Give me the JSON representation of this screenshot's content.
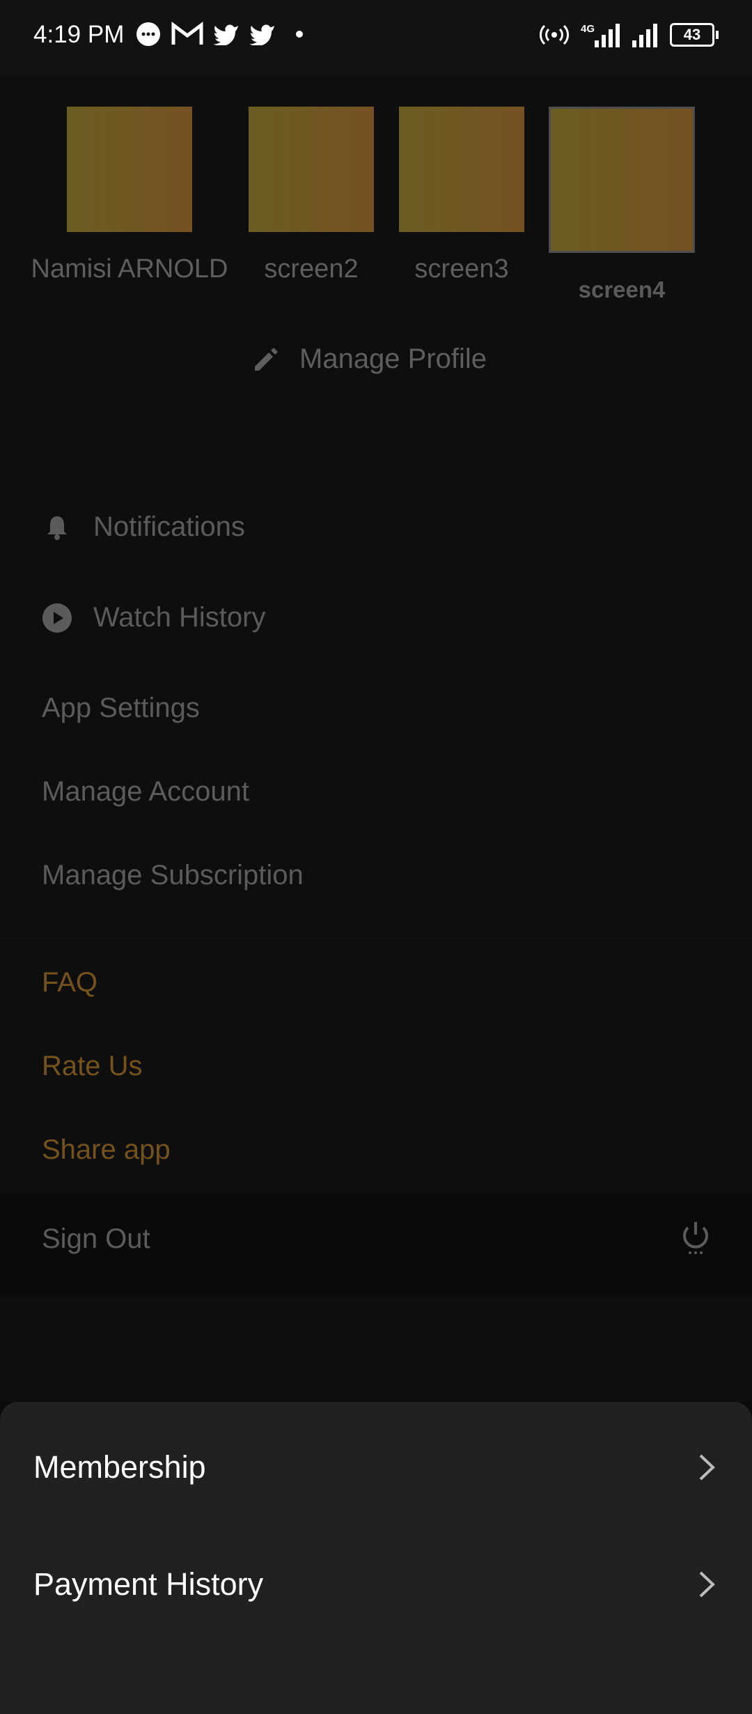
{
  "status_bar": {
    "time": "4:19 PM",
    "left_icons": [
      "chat-bubble-icon",
      "gmail-icon",
      "twitter-icon",
      "twitter-icon",
      "dot-icon"
    ],
    "right_icons": [
      "hotspot-icon",
      "signal-4g-icon",
      "signal-icon",
      "battery-icon"
    ],
    "battery": "43"
  },
  "profiles": [
    {
      "name": "Namisi ARNOLD",
      "selected": false
    },
    {
      "name": "screen2",
      "selected": false
    },
    {
      "name": "screen3",
      "selected": false
    },
    {
      "name": "screen4",
      "selected": true
    }
  ],
  "manage_profile": "Manage Profile",
  "menu": {
    "notifications": "Notifications",
    "watch_history": "Watch History",
    "app_settings": "App Settings",
    "manage_account": "Manage Account",
    "manage_subscription": "Manage Subscription",
    "faq": "FAQ",
    "rate_us": "Rate Us",
    "share_app": "Share app",
    "sign_out": "Sign Out"
  },
  "sheet": {
    "membership": "Membership",
    "payment_history": "Payment History"
  },
  "colors": {
    "accent_gold": "#74521c",
    "sheet_bg": "#212121",
    "dim_text": "#5b5b5b"
  }
}
